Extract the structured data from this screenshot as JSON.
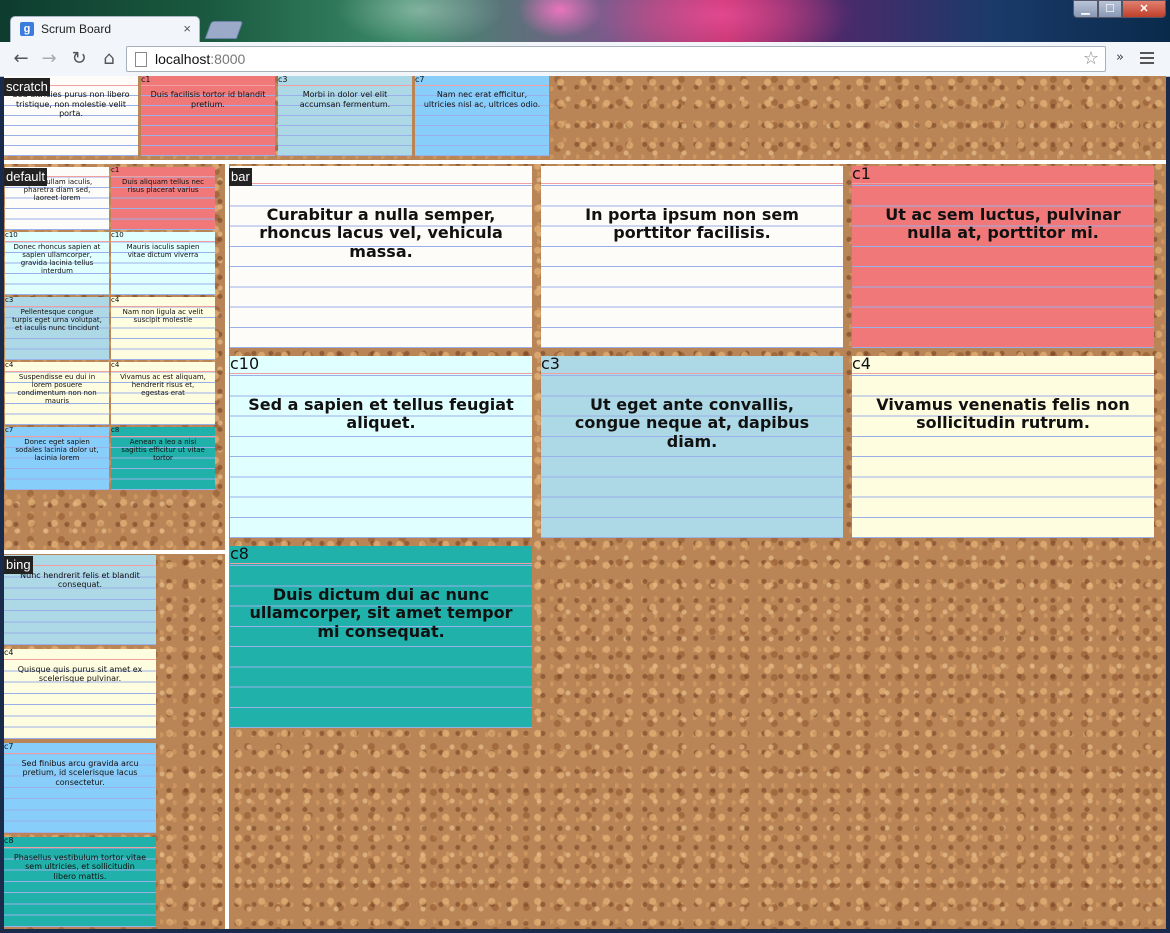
{
  "browser": {
    "tab_title": "Scrum Board",
    "tab_favicon": "g",
    "tab_close": "×",
    "url_host": "localhost",
    "url_port": ":8000",
    "window_controls": {
      "minimize": "▁",
      "maximize": "☐",
      "close": "✕"
    },
    "nav": {
      "back": "←",
      "forward": "→",
      "reload": "↻",
      "home": "⌂"
    },
    "star": "☆",
    "extensions_more": "»"
  },
  "colors": {
    "white": "#fdfcf8",
    "red": "#f07878",
    "lightblue": "#add8e6",
    "skyblue": "#87cefa",
    "cyan": "#e0ffff",
    "yellow": "#fffde0",
    "teal": "#20b2aa",
    "pink_line": "#f0a0a0",
    "blue_line": "#9ab0e8"
  },
  "boards": {
    "scratch": {
      "label": "scratch",
      "cards": [
        {
          "code": "",
          "text": "Sed ultricies purus non libero tristique, non molestie velit porta.",
          "color": "white"
        },
        {
          "code": "c1",
          "text": "Duis facilisis tortor id blandit pretium.",
          "color": "red"
        },
        {
          "code": "c3",
          "text": "Morbi in dolor vel elit accumsan fermentum.",
          "color": "lightblue"
        },
        {
          "code": "c7",
          "text": "Nam nec erat efficitur, ultricies nisl ac, ultrices odio.",
          "color": "skyblue"
        }
      ]
    },
    "default": {
      "label": "default",
      "cards": [
        {
          "code": "",
          "text": "Nulla nullam iaculis, pharetra diam sed, laoreet lorem",
          "color": "white"
        },
        {
          "code": "c1",
          "text": "Duis aliquam tellus nec risus placerat varius",
          "color": "red"
        },
        {
          "code": "c10",
          "text": "Donec rhoncus sapien at sapien ullamcorper, gravida lacinia tellus interdum",
          "color": "cyan"
        },
        {
          "code": "c10",
          "text": "Mauris iaculis sapien vitae dictum viverra",
          "color": "cyan"
        },
        {
          "code": "c3",
          "text": "Pellentesque congue turpis eget urna volutpat, et iaculis nunc tincidunt",
          "color": "lightblue"
        },
        {
          "code": "c4",
          "text": "Nam non ligula ac velit suscipit molestie",
          "color": "yellow"
        },
        {
          "code": "c4",
          "text": "Suspendisse eu dui in lorem posuere condimentum non non mauris",
          "color": "yellow"
        },
        {
          "code": "c4",
          "text": "Vivamus ac est aliquam, hendrerit risus et, egestas erat",
          "color": "yellow"
        },
        {
          "code": "c7",
          "text": "Donec eget sapien sodales lacinia dolor ut, lacinia lorem",
          "color": "skyblue"
        },
        {
          "code": "c8",
          "text": "Aenean a leo a nisi sagittis efficitur ut vitae tortor",
          "color": "teal"
        }
      ]
    },
    "bar": {
      "label": "bar",
      "cards": [
        {
          "code": "",
          "text": "Curabitur a nulla semper, rhoncus lacus vel, vehicula massa.",
          "color": "white"
        },
        {
          "code": "",
          "text": "In porta ipsum non sem porttitor facilisis.",
          "color": "white"
        },
        {
          "code": "c1",
          "text": "Ut ac sem luctus, pulvinar nulla at, porttitor mi.",
          "color": "red"
        },
        {
          "code": "c10",
          "text": "Sed a sapien et tellus feugiat aliquet.",
          "color": "cyan"
        },
        {
          "code": "c3",
          "text": "Ut eget ante convallis, congue neque at, dapibus diam.",
          "color": "lightblue"
        },
        {
          "code": "c4",
          "text": "Vivamus venenatis felis non sollicitudin rutrum.",
          "color": "yellow"
        },
        {
          "code": "c8",
          "text": "Duis dictum dui ac nunc ullamcorper, sit amet tempor mi consequat.",
          "color": "teal"
        }
      ]
    },
    "bing": {
      "label": "bing",
      "cards": [
        {
          "code": "",
          "text": "Nunc hendrerit felis et blandit consequat.",
          "color": "lightblue"
        },
        {
          "code": "c4",
          "text": "Quisque quis purus sit amet ex scelerisque pulvinar.",
          "color": "yellow"
        },
        {
          "code": "c7",
          "text": "Sed finibus arcu gravida arcu pretium, id scelerisque lacus consectetur.",
          "color": "skyblue"
        },
        {
          "code": "c8",
          "text": "Phasellus vestibulum tortor vitae sem ultricies, et sollicitudin libero mattis.",
          "color": "teal"
        }
      ]
    }
  }
}
